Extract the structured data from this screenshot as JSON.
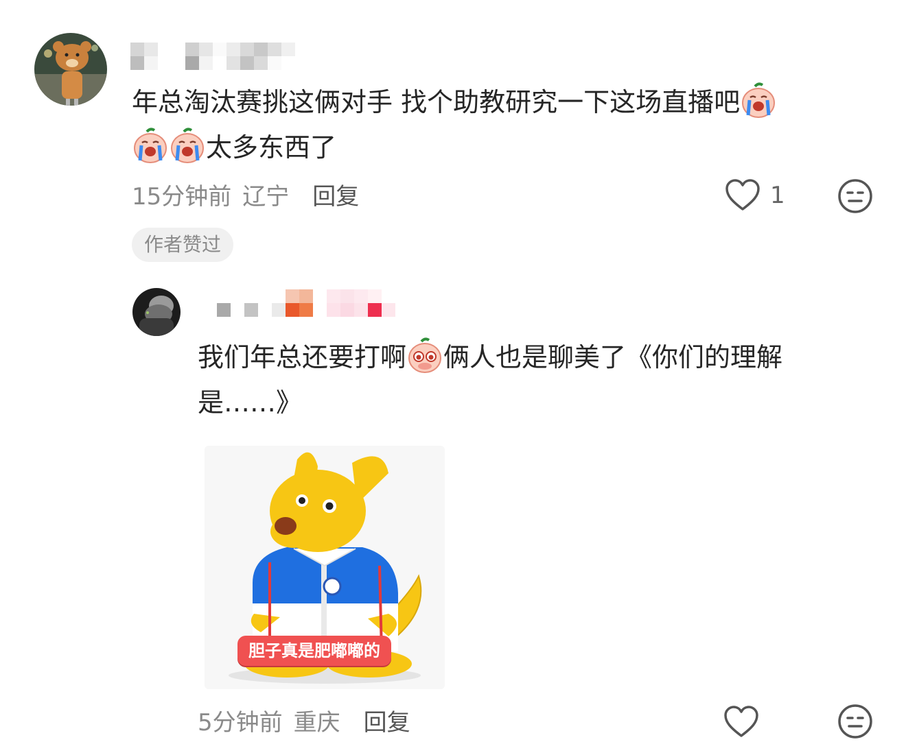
{
  "comments": [
    {
      "text_line1": "年总淘汰赛挑这俩对手  找个助教研究一下这场直播吧",
      "text_line2": "太多东西了",
      "time": "15分钟前",
      "location": "辽宁",
      "reply_label": "回复",
      "like_count": "1",
      "badge": "作者赞过",
      "emojis": [
        "crying-peach-icon",
        "crying-peach-icon",
        "crying-peach-icon"
      ]
    },
    {
      "text_line1_a": "我们年总还要打啊",
      "text_line1_b": "俩人也是聊美了《你们的理解",
      "text_line2": "是……》",
      "time": "5分钟前",
      "location": "重庆",
      "reply_label": "回复",
      "sticker_caption": "胆子真是肥嘟嘟的",
      "emojis": [
        "pleading-peach-icon"
      ]
    }
  ],
  "colors": {
    "accent_red": "#f05151",
    "mascot_yellow": "#f7c614",
    "jacket_blue": "#1f6fe0",
    "meta_gray": "#8a8a8a"
  }
}
